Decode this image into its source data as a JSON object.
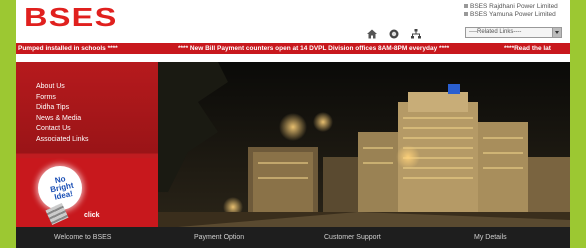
{
  "header": {
    "logo": "BSES",
    "companies": [
      "BSES Rajdhani Power Limited",
      "BSES Yamuna Power Limited"
    ],
    "related_links_select": "----Related Links----"
  },
  "ticker": {
    "items": [
      "Pumped installed in schools ****",
      "**** New Bill Payment counters open at 14 DVPL Division offices 8AM-8PM everyday ****",
      "****Read the lat"
    ]
  },
  "menu": {
    "items": [
      "About Us",
      "Forms",
      "Didha Tips",
      "News & Media",
      "Contact Us",
      "Associated Links"
    ],
    "bulb_text": "No Bright Idea!",
    "click_label": "click"
  },
  "bottom_nav": {
    "items": [
      "Welcome to BSES",
      "Payment Option",
      "Customer Support",
      "My Details"
    ]
  },
  "colors": {
    "brand_red": "#e0201e",
    "ticker_red": "#c8181d",
    "page_bg": "#9cc832",
    "nav_bg": "#1e1e1e"
  },
  "icons": [
    "home-icon",
    "search-icon",
    "sitemap-icon"
  ]
}
